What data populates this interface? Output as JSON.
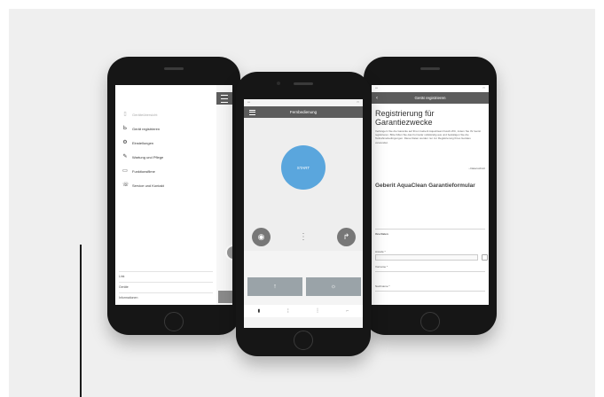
{
  "left_phone": {
    "menu_items": [
      {
        "label": "Geräteübersicht",
        "icon": "device-icon",
        "dim": true
      },
      {
        "label": "Gerät registrieren",
        "icon": "register-icon",
        "dim": false
      },
      {
        "label": "Einstellungen",
        "icon": "gear-icon",
        "dim": false
      },
      {
        "label": "Wartung und Pflege",
        "icon": "wrench-icon",
        "dim": false
      },
      {
        "label": "Funktionsfilme",
        "icon": "film-icon",
        "dim": false
      },
      {
        "label": "Service und Kontakt",
        "icon": "chat-icon",
        "dim": false
      }
    ],
    "footer_links": [
      "Link",
      "Geräte",
      "Informationen"
    ]
  },
  "center_phone": {
    "header_title": "Fernbedienung",
    "start_label": "START",
    "buttons": [
      "↑",
      "☼"
    ]
  },
  "right_phone": {
    "header_title": "Gerät registrieren",
    "title": "Registrierung für Garantiezwecke",
    "body": "Verlängern Sie die Garantie auf Ihren Geberit AquaClean Dusch-WC, indem Sie Ihr Gerät registrieren. Bitte füllen Sie das Formular vollständig aus und bestätigen Sie die Teilnahmebedingungen. Diese Daten werden nur zur Registrierung Ihres Gerätes verwendet.",
    "link": "› Datenschutz",
    "subtitle": "Geberit AquaClean Garantieformular",
    "fields": [
      "Ihre Daten",
      "Anrede *",
      "Vorname *",
      "Nachname *"
    ]
  }
}
